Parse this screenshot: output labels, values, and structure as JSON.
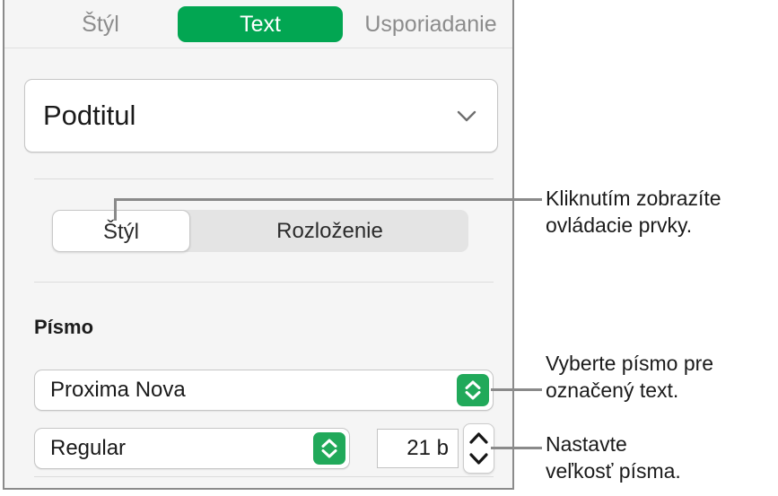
{
  "panel": {
    "tabs": [
      {
        "label": "Štýl",
        "selected": false,
        "name": "tab-style"
      },
      {
        "label": "Text",
        "selected": true,
        "name": "tab-text"
      },
      {
        "label": "Usporiadanie",
        "selected": false,
        "name": "tab-arrange"
      }
    ],
    "paragraph_style": {
      "value": "Podtitul",
      "icon": "chevron-down-icon"
    },
    "style_layout_segment": [
      {
        "label": "Štýl",
        "selected": true
      },
      {
        "label": "Rozloženie",
        "selected": false
      }
    ],
    "font_section": {
      "label": "Písmo",
      "family": {
        "value": "Proxima Nova",
        "stepper_icon": "up-down-chevron-icon"
      },
      "style": {
        "value": "Regular",
        "stepper_icon": "up-down-chevron-icon"
      },
      "size": {
        "value": "21 b",
        "stepper_icon": "up-down-chevron-icon"
      }
    }
  },
  "callouts": [
    {
      "text": "Kliknutím zobrazíte\novládacie prvky."
    },
    {
      "text": "Vyberte písmo pre\noznačený text."
    },
    {
      "text": "Nastavte\nveľkosť písma."
    }
  ],
  "colors": {
    "accent_green": "#02a652",
    "stepper_green": "#21a95a",
    "panel_bg": "#f5f5f5",
    "leader_line": "#8a8a8a"
  }
}
